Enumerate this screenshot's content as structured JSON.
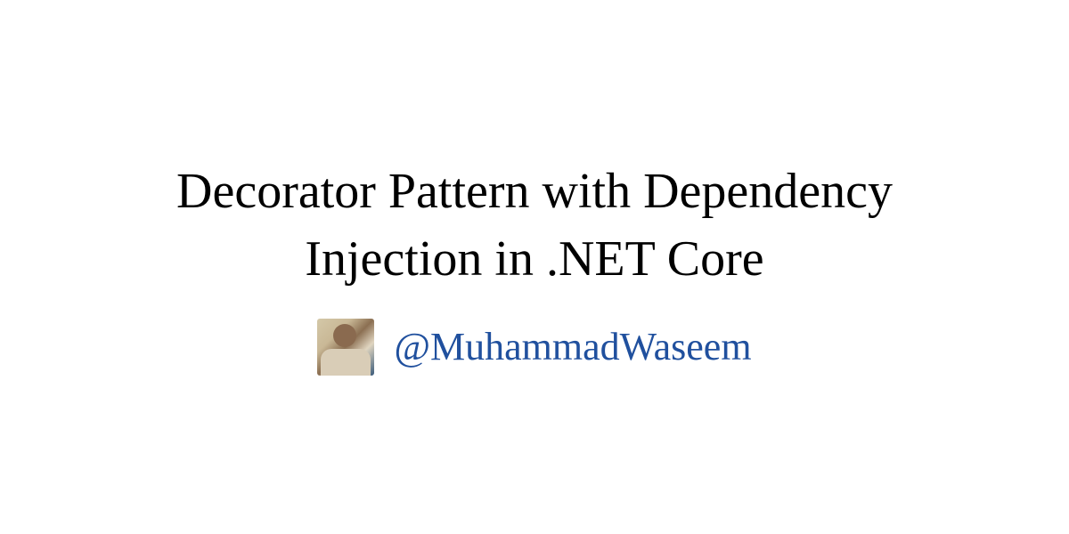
{
  "title": "Decorator Pattern with Dependency Injection in .NET Core",
  "author": {
    "handle": "@MuhammadWaseem"
  },
  "colors": {
    "accent": "#20509e",
    "text": "#000000",
    "background": "#ffffff"
  }
}
